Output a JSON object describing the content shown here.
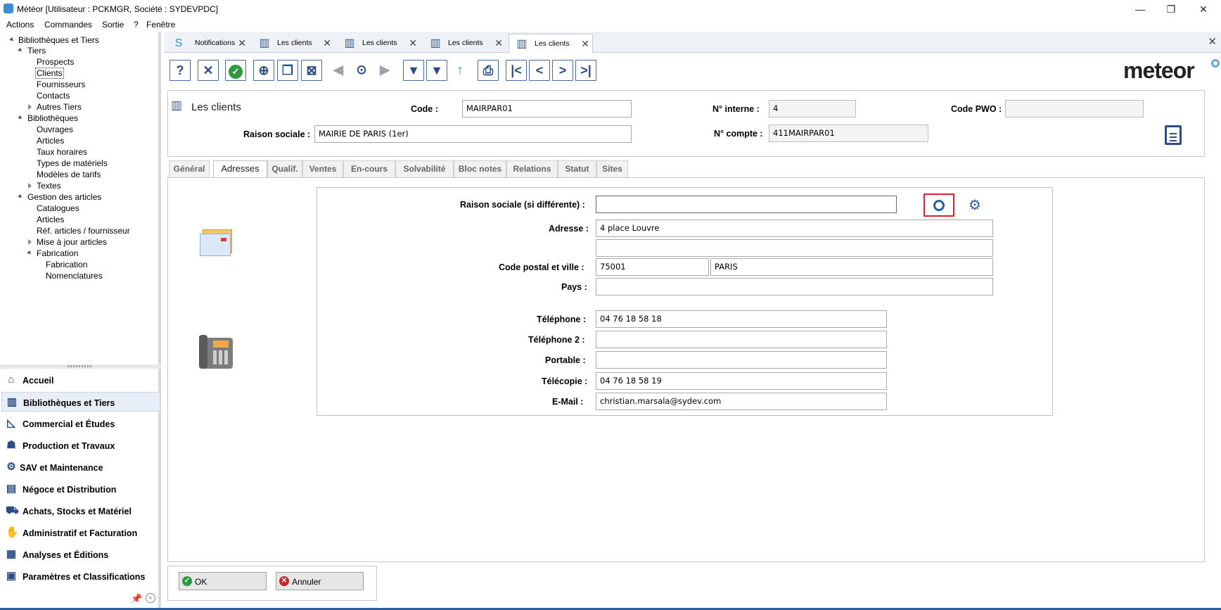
{
  "window": {
    "title": "Météor [Utilisateur : PCKMGR, Société : SYDEVPDC]",
    "minimize": "—",
    "restore": "❐",
    "close": "✕"
  },
  "menu": [
    "Actions",
    "Commandes",
    "Sortie",
    "?",
    "Fenêtre"
  ],
  "tree": [
    {
      "label": "Bibliothèques et Tiers"
    },
    {
      "label": "Tiers"
    },
    {
      "label": "Prospects"
    },
    {
      "label": "Clients"
    },
    {
      "label": "Fournisseurs"
    },
    {
      "label": "Contacts"
    },
    {
      "label": "Autres Tiers"
    },
    {
      "label": "Bibliothèques"
    },
    {
      "label": "Ouvrages"
    },
    {
      "label": "Articles"
    },
    {
      "label": "Taux horaires"
    },
    {
      "label": "Types de matériels"
    },
    {
      "label": "Modèles de tarifs"
    },
    {
      "label": "Textes"
    },
    {
      "label": "Gestion des articles"
    },
    {
      "label": "Catalogues"
    },
    {
      "label": "Articles"
    },
    {
      "label": "Réf. articles / fournisseur"
    },
    {
      "label": "Mise à jour articles"
    },
    {
      "label": "Fabrication"
    },
    {
      "label": "Fabrication"
    },
    {
      "label": "Nomenclatures"
    }
  ],
  "modules": [
    {
      "label": "Accueil",
      "icon": "home-icon"
    },
    {
      "label": "Bibliothèques et Tiers",
      "icon": "books-icon"
    },
    {
      "label": "Commercial et Études",
      "icon": "ruler-icon"
    },
    {
      "label": "Production et Travaux",
      "icon": "worker-icon"
    },
    {
      "label": "SAV et Maintenance",
      "icon": "gears-icon"
    },
    {
      "label": "Négoce et Distribution",
      "icon": "store-icon"
    },
    {
      "label": "Achats, Stocks et Matériel",
      "icon": "cart-icon"
    },
    {
      "label": "Administratif et Facturation",
      "icon": "money-icon"
    },
    {
      "label": "Analyses et Éditions",
      "icon": "report-icon"
    },
    {
      "label": "Paramètres et Classifications",
      "icon": "settings-icon"
    }
  ],
  "tabs": [
    "Notifications",
    "Les clients",
    "Les clients",
    "Les clients",
    "Les clients"
  ],
  "logo": "meteor",
  "header": {
    "title": "Les clients",
    "code_label": "Code :",
    "code_value": "MAIRPAR01",
    "interne_label": "N° interne :",
    "interne_value": "4",
    "pwo_label": "Code PWO :",
    "pwo_value": "",
    "raison_label": "Raison sociale :",
    "raison_value": "MAIRIE DE PARIS (1er)",
    "compte_label": "N° compte :",
    "compte_value": "411MAIRPAR01"
  },
  "subtabs": [
    "Général",
    "Adresses",
    "Qualif.",
    "Ventes",
    "En-cours",
    "Solvabilité",
    "Bloc notes",
    "Relations",
    "Statut",
    "Sites"
  ],
  "address": {
    "raison_label": "Raison sociale (si différente) :",
    "raison_value": "",
    "adresse_label": "Adresse :",
    "adresse1": "4 place Louvre",
    "adresse2": "",
    "cpville_label": "Code postal et ville :",
    "cp": "75001",
    "ville": "PARIS",
    "pays_label": "Pays :",
    "pays": "",
    "tel_label": "Téléphone :",
    "tel": "04 76 18 58 18",
    "tel2_label": "Téléphone 2 :",
    "tel2": "",
    "portable_label": "Portable :",
    "portable": "",
    "fax_label": "Télécopie :",
    "fax": "04 76 18 58 19",
    "email_label": "E-Mail :",
    "email": "christian.marsala@sydev.com"
  },
  "buttons": {
    "ok": "OK",
    "cancel": "Annuler"
  },
  "colors": {
    "accent": "#2b4c86",
    "highlight_box": "#d4262b",
    "ok_green": "#2e9a3e",
    "cancel_red": "#c62828"
  }
}
